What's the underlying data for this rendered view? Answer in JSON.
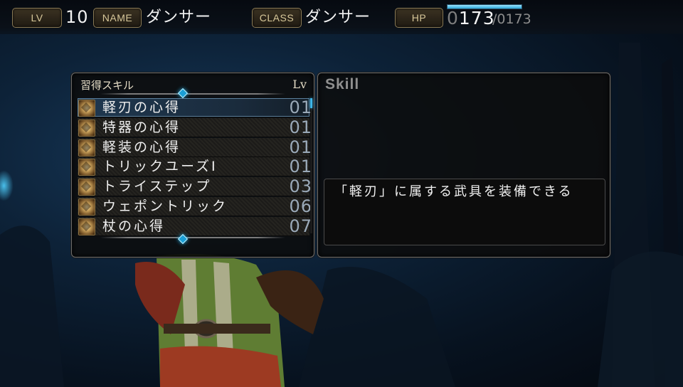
{
  "status": {
    "lv_label": "LV",
    "lv_value": "10",
    "name_label": "NAME",
    "name_value": "ダンサー",
    "class_label": "CLASS",
    "class_value": "ダンサー",
    "hp_label": "HP",
    "hp_current_lead": "0",
    "hp_current": "173",
    "hp_max": "/0173",
    "hp_fraction": 1.0
  },
  "skills_panel": {
    "title": "習得スキル",
    "lv_header": "Lv",
    "icon": "skill-crest-icon",
    "skills": [
      {
        "name": "軽刃の心得",
        "lv": "01"
      },
      {
        "name": "特器の心得",
        "lv": "01"
      },
      {
        "name": "軽装の心得",
        "lv": "01"
      },
      {
        "name": "トリックユーズⅠ",
        "lv": "01"
      },
      {
        "name": "トライステップ",
        "lv": "03"
      },
      {
        "name": "ウェポントリック",
        "lv": "06"
      },
      {
        "name": "杖の心得",
        "lv": "07"
      }
    ],
    "selected_index": 0
  },
  "detail_panel": {
    "header": "Skill",
    "description": "「軽刃」に属する武具を装備できる"
  },
  "colors": {
    "accent": "#2aa6d8",
    "tag_border": "#8a7a55",
    "panel_border": "#6e6e6e"
  }
}
